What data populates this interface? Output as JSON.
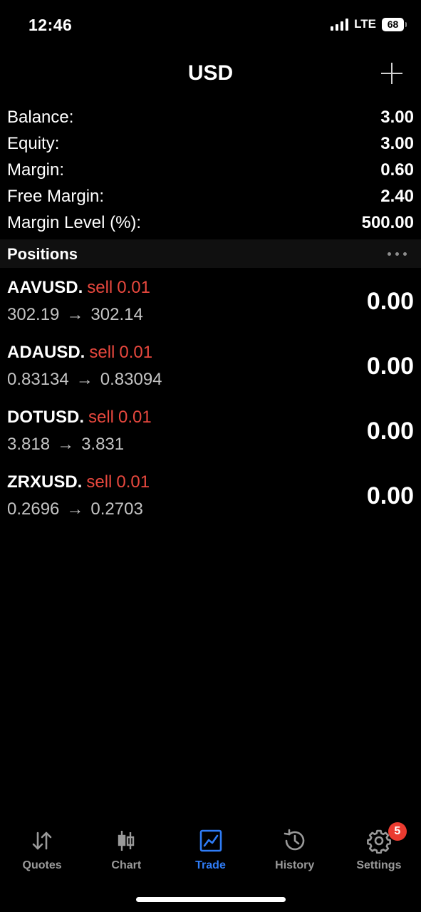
{
  "status_bar": {
    "time": "12:46",
    "network": "LTE",
    "battery": "68"
  },
  "header": {
    "title": "USD",
    "add_icon": "plus-icon"
  },
  "summary": [
    {
      "label": "Balance:",
      "value": "3.00"
    },
    {
      "label": "Equity:",
      "value": "3.00"
    },
    {
      "label": "Margin:",
      "value": "0.60"
    },
    {
      "label": "Free Margin:",
      "value": "2.40"
    },
    {
      "label": "Margin Level (%):",
      "value": "500.00"
    }
  ],
  "positions": {
    "title": "Positions",
    "more_icon": "more-horizontal-icon",
    "items": [
      {
        "symbol": "AAVUSD.",
        "type": "sell",
        "volume": "0.01",
        "open_price": "302.19",
        "arrow": "→",
        "current_price": "302.14",
        "profit": "0.00"
      },
      {
        "symbol": "ADAUSD.",
        "type": "sell",
        "volume": "0.01",
        "open_price": "0.83134",
        "arrow": "→",
        "current_price": "0.83094",
        "profit": "0.00"
      },
      {
        "symbol": "DOTUSD.",
        "type": "sell",
        "volume": "0.01",
        "open_price": "3.818",
        "arrow": "→",
        "current_price": "3.831",
        "profit": "0.00"
      },
      {
        "symbol": "ZRXUSD.",
        "type": "sell",
        "volume": "0.01",
        "open_price": "0.2696",
        "arrow": "→",
        "current_price": "0.2703",
        "profit": "0.00"
      }
    ]
  },
  "tab_bar": {
    "active_color": "#2f7cf6",
    "inactive_color": "#9a9a9a",
    "tabs": [
      {
        "label": "Quotes",
        "icon": "quotes-arrows-icon",
        "active": false
      },
      {
        "label": "Chart",
        "icon": "candlestick-icon",
        "active": false
      },
      {
        "label": "Trade",
        "icon": "trade-chart-icon",
        "active": true
      },
      {
        "label": "History",
        "icon": "history-clock-icon",
        "active": false
      },
      {
        "label": "Settings",
        "icon": "gear-icon",
        "active": false,
        "badge": "5"
      }
    ]
  },
  "colors": {
    "background": "#000000",
    "sell": "#e8483e",
    "badge": "#eb3b30"
  }
}
